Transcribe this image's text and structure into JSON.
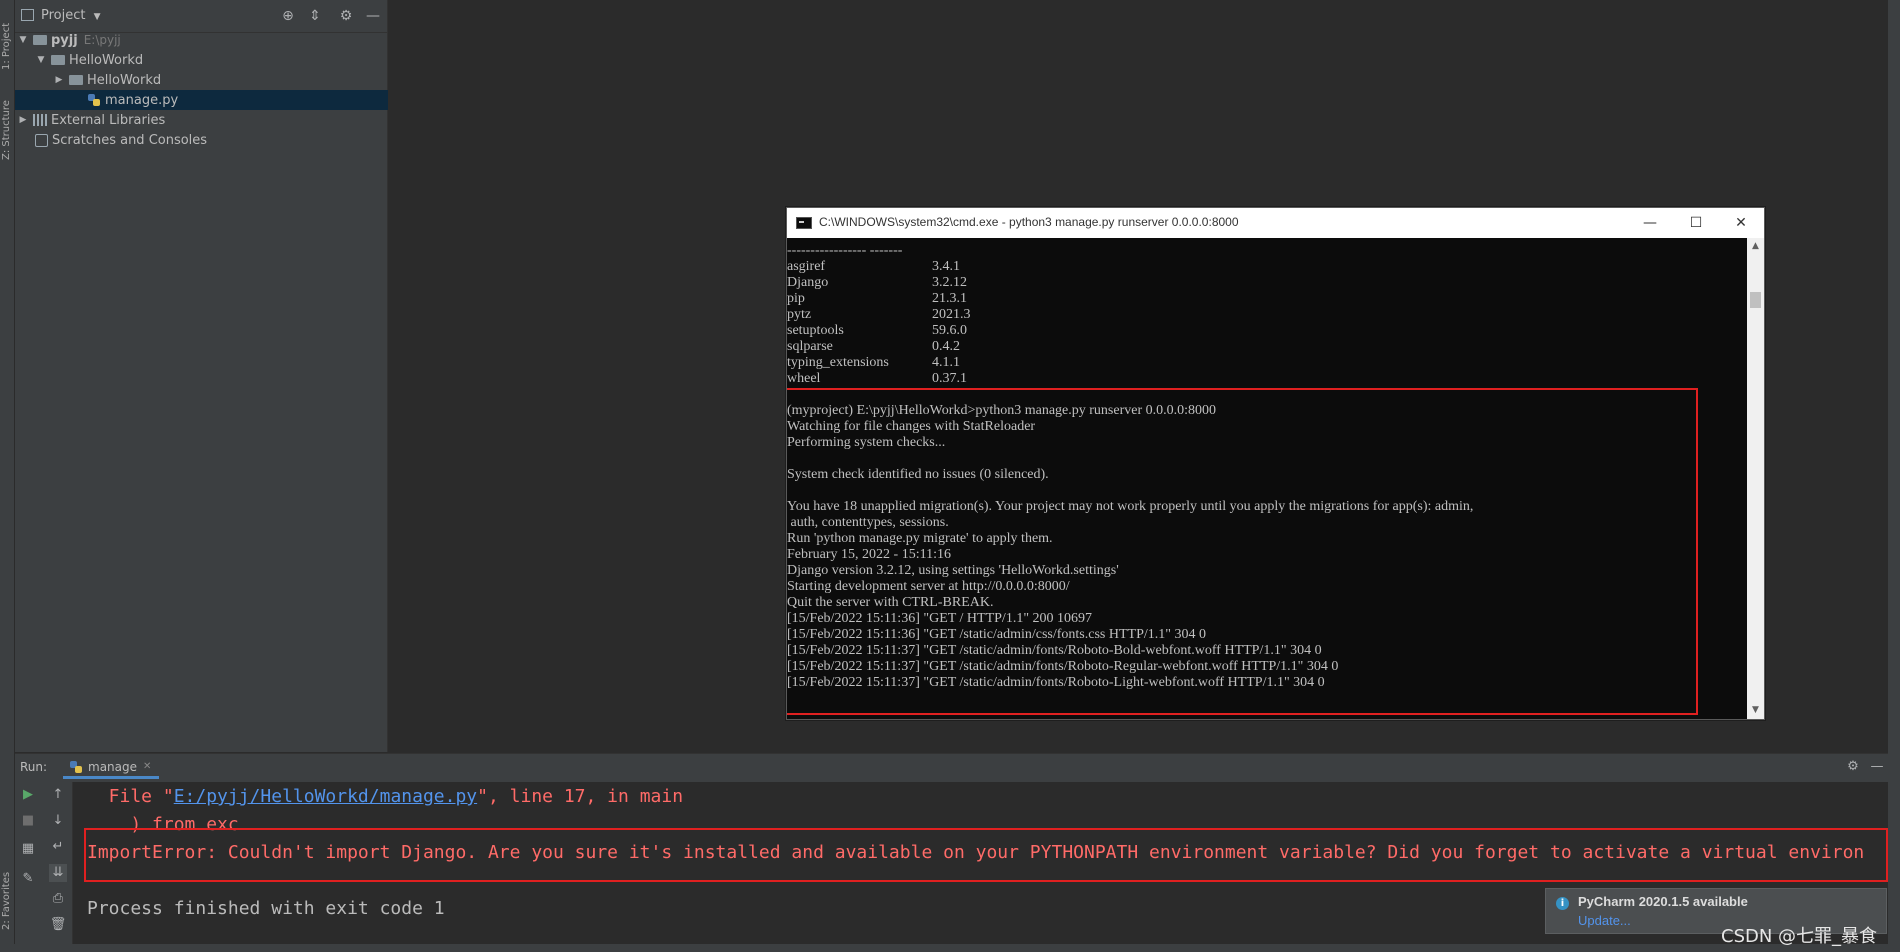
{
  "side_tabs": {
    "project": "1: Project",
    "structure": "Z: Structure",
    "favorites": "2: Favorites"
  },
  "project_panel": {
    "title": "Project",
    "tree": [
      {
        "label": "pyjj",
        "path": "E:\\pyjj"
      },
      {
        "label": "HelloWorkd"
      },
      {
        "label": "HelloWorkd"
      },
      {
        "label": "manage.py"
      },
      {
        "label": "External Libraries"
      },
      {
        "label": "Scratches and Consoles"
      }
    ]
  },
  "cmd": {
    "title": "C:\\WINDOWS\\system32\\cmd.exe - python3  manage.py runserver 0.0.0.0:8000",
    "separator": "----------------- -------",
    "packages": [
      {
        "name": "asgiref",
        "version": "3.4.1"
      },
      {
        "name": "Django",
        "version": "3.2.12"
      },
      {
        "name": "pip",
        "version": "21.3.1"
      },
      {
        "name": "pytz",
        "version": "2021.3"
      },
      {
        "name": "setuptools",
        "version": "59.6.0"
      },
      {
        "name": "sqlparse",
        "version": "0.4.2"
      },
      {
        "name": "typing_extensions",
        "version": "4.1.1"
      },
      {
        "name": "wheel",
        "version": "0.37.1"
      }
    ],
    "lines": [
      "(myproject) E:\\pyjj\\HelloWorkd>python3 manage.py runserver 0.0.0.0:8000",
      "Watching for file changes with StatReloader",
      "Performing system checks...",
      "",
      "System check identified no issues (0 silenced).",
      "",
      "You have 18 unapplied migration(s). Your project may not work properly until you apply the migrations for app(s): admin,",
      " auth, contenttypes, sessions.",
      "Run 'python manage.py migrate' to apply them.",
      "February 15, 2022 - 15:11:16",
      "Django version 3.2.12, using settings 'HelloWorkd.settings'",
      "Starting development server at http://0.0.0.0:8000/",
      "Quit the server with CTRL-BREAK.",
      "[15/Feb/2022 15:11:36] \"GET / HTTP/1.1\" 200 10697",
      "[15/Feb/2022 15:11:36] \"GET /static/admin/css/fonts.css HTTP/1.1\" 304 0",
      "[15/Feb/2022 15:11:37] \"GET /static/admin/fonts/Roboto-Bold-webfont.woff HTTP/1.1\" 304 0",
      "[15/Feb/2022 15:11:37] \"GET /static/admin/fonts/Roboto-Regular-webfont.woff HTTP/1.1\" 304 0",
      "[15/Feb/2022 15:11:37] \"GET /static/admin/fonts/Roboto-Light-webfont.woff HTTP/1.1\" 304 0"
    ]
  },
  "run_panel": {
    "label": "Run:",
    "tab": "manage",
    "console": {
      "file_prefix": "  File \"",
      "file_link": "E:/pyjj/HelloWorkd/manage.py",
      "file_suffix": "\", line 17, in main",
      "from_exc": "    ) from exc",
      "import_error": "ImportError: Couldn't import Django. Are you sure it's installed and available on your PYTHONPATH environment variable? Did you forget to activate a virtual environ",
      "finished": "Process finished with exit code 1"
    }
  },
  "notification": {
    "title": "PyCharm 2020.1.5 available",
    "link": "Update..."
  },
  "watermark": "CSDN @七罪_暴食",
  "colors": {
    "error": "#ff6b68",
    "link": "#5394ec",
    "highlight_box": "#e02020"
  }
}
